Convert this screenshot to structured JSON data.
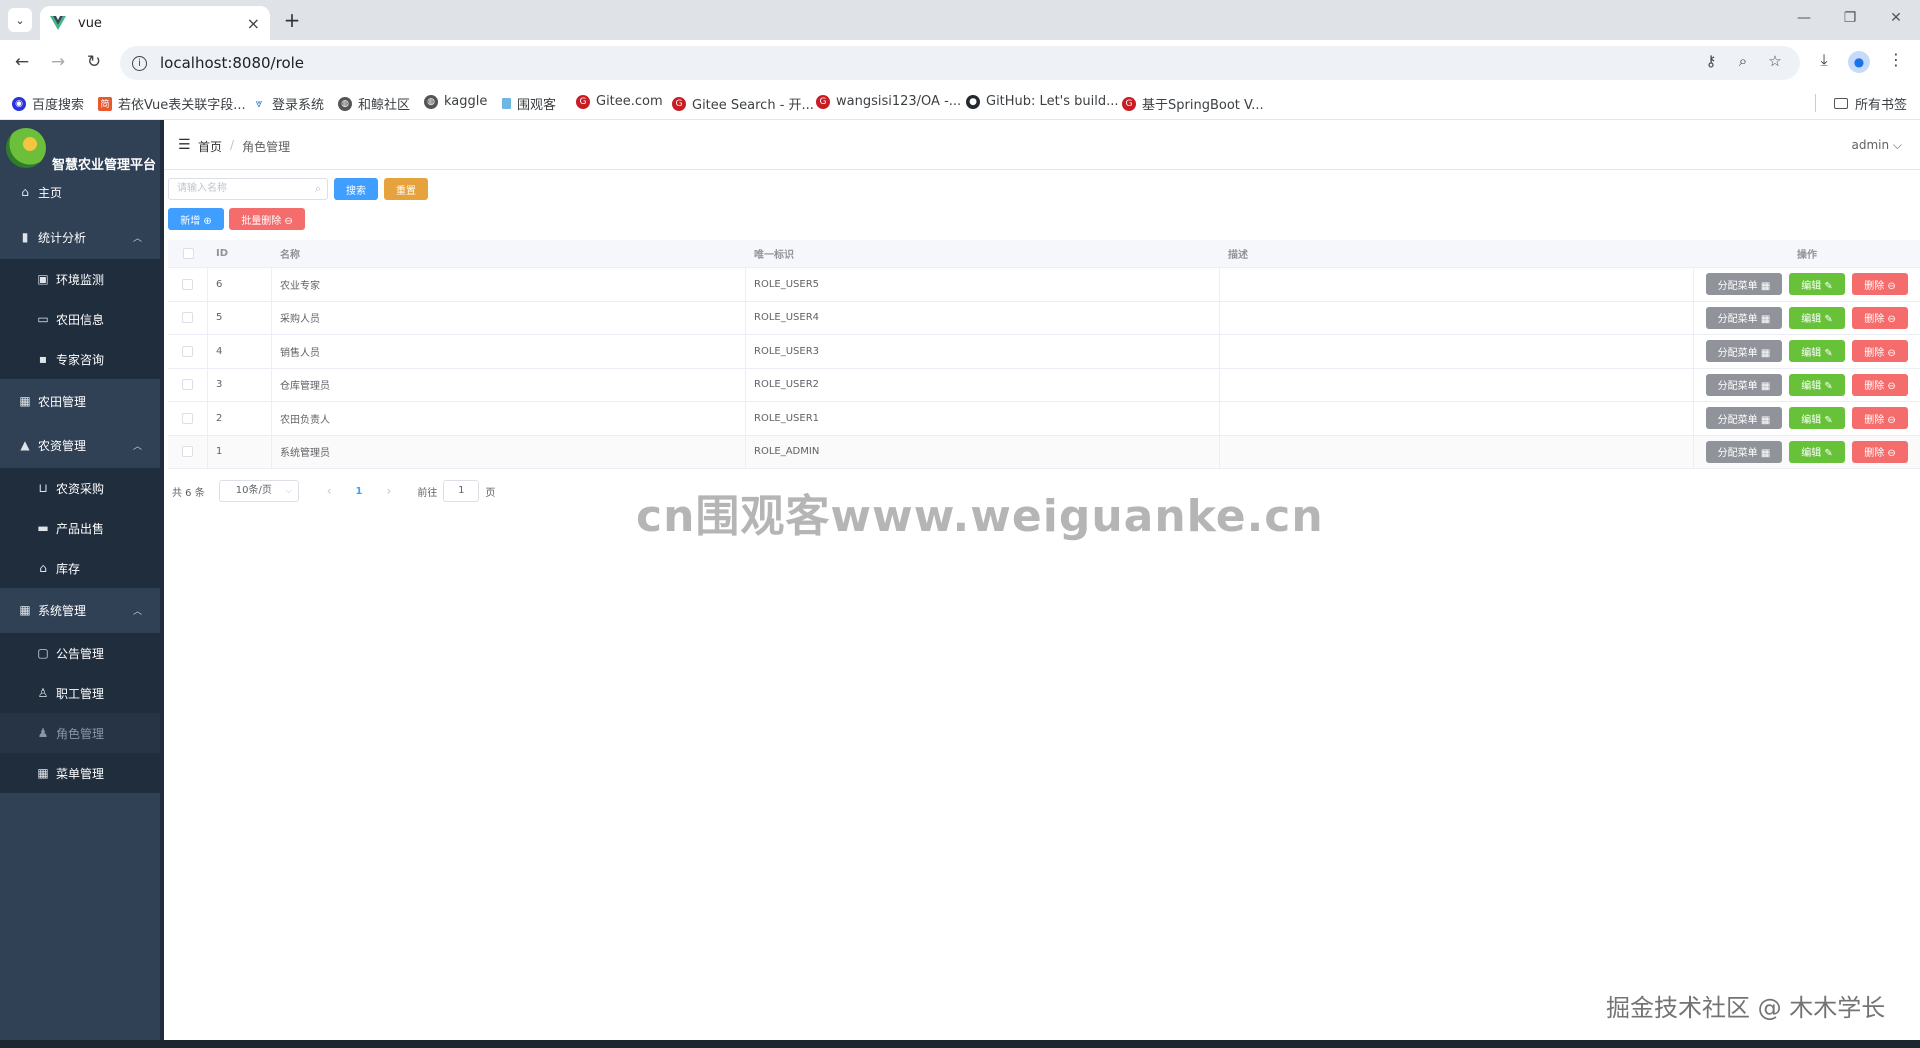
{
  "browser": {
    "tab_title": "vue",
    "url": "localhost:8080/role",
    "bookmarks": [
      {
        "label": "百度搜索",
        "icon": "baidu-icon",
        "color": "#2932e1"
      },
      {
        "label": "若依Vue表关联字段...",
        "icon": "jian-icon",
        "color": "#e8582c"
      },
      {
        "label": "登录系统",
        "icon": "leaf-icon",
        "color": "#3a7bd5"
      },
      {
        "label": "和鲸社区",
        "icon": "globe-icon",
        "color": "#555555"
      },
      {
        "label": "kaggle",
        "icon": "globe-icon",
        "color": "#555555"
      },
      {
        "label": "围观客",
        "icon": "page-icon",
        "color": "#6fb6e0"
      },
      {
        "label": "Gitee.com",
        "icon": "gitee-icon",
        "color": "#c71d23"
      },
      {
        "label": "Gitee Search - 开...",
        "icon": "gitee-icon",
        "color": "#c71d23"
      },
      {
        "label": "wangsisi123/OA -...",
        "icon": "gitee-icon",
        "color": "#c71d23"
      },
      {
        "label": "GitHub: Let's build...",
        "icon": "github-icon",
        "color": "#24292f"
      },
      {
        "label": "基于SpringBoot V...",
        "icon": "gitee-icon",
        "color": "#c71d23"
      }
    ],
    "all_bookmarks": "所有书签"
  },
  "sidebar": {
    "brand": "智慧农业管理平台",
    "items": [
      {
        "label": "主页",
        "icon": "home-icon",
        "glyph": "⌂",
        "level": "top"
      },
      {
        "label": "统计分析",
        "icon": "bar-chart-icon",
        "glyph": "▮",
        "level": "top",
        "expanded": true
      },
      {
        "label": "环境监测",
        "icon": "monitor-icon",
        "glyph": "▣",
        "level": "sub"
      },
      {
        "label": "农田信息",
        "icon": "board-icon",
        "glyph": "▭",
        "level": "sub"
      },
      {
        "label": "专家咨询",
        "icon": "chat-icon",
        "glyph": "▪",
        "level": "sub"
      },
      {
        "label": "农田管理",
        "icon": "grid-icon",
        "glyph": "▦",
        "level": "top"
      },
      {
        "label": "农资管理",
        "icon": "lock-icon",
        "glyph": "▲",
        "level": "top",
        "expanded": true
      },
      {
        "label": "农资采购",
        "icon": "cart-icon",
        "glyph": "⊔",
        "level": "sub"
      },
      {
        "label": "产品出售",
        "icon": "bag-icon",
        "glyph": "▬",
        "level": "sub"
      },
      {
        "label": "库存",
        "icon": "house-icon",
        "glyph": "⌂",
        "level": "sub"
      },
      {
        "label": "系统管理",
        "icon": "apps-icon",
        "glyph": "▦",
        "level": "top",
        "expanded": true
      },
      {
        "label": "公告管理",
        "icon": "notice-icon",
        "glyph": "▢",
        "level": "sub"
      },
      {
        "label": "职工管理",
        "icon": "user-icon",
        "glyph": "♙",
        "level": "sub"
      },
      {
        "label": "角色管理",
        "icon": "role-icon",
        "glyph": "♟",
        "level": "sub",
        "active": true
      },
      {
        "label": "菜单管理",
        "icon": "menu-grid-icon",
        "glyph": "▦",
        "level": "sub"
      }
    ]
  },
  "header": {
    "breadcrumb_home": "首页",
    "breadcrumb_sep": "/",
    "breadcrumb_current": "角色管理",
    "user": "admin ⌵"
  },
  "toolbar": {
    "search_placeholder": "请输入名称",
    "search_btn": "搜索",
    "reset_btn": "重置",
    "add_btn": "新增 ⊕",
    "batch_delete_btn": "批量删除 ⊖"
  },
  "table": {
    "columns": {
      "id": "ID",
      "name": "名称",
      "flag": "唯一标识",
      "desc": "描述",
      "ops": "操作"
    },
    "rows": [
      {
        "id": "6",
        "name": "农业专家",
        "flag": "ROLE_USER5",
        "desc": ""
      },
      {
        "id": "5",
        "name": "采购人员",
        "flag": "ROLE_USER4",
        "desc": ""
      },
      {
        "id": "4",
        "name": "销售人员",
        "flag": "ROLE_USER3",
        "desc": ""
      },
      {
        "id": "3",
        "name": "仓库管理员",
        "flag": "ROLE_USER2",
        "desc": ""
      },
      {
        "id": "2",
        "name": "农田负责人",
        "flag": "ROLE_USER1",
        "desc": ""
      },
      {
        "id": "1",
        "name": "系统管理员",
        "flag": "ROLE_ADMIN",
        "desc": ""
      }
    ],
    "assign_menu_btn": "分配菜单 ▦",
    "edit_btn": "编辑 ✎",
    "delete_btn": "删除 ⊖"
  },
  "pagination": {
    "total": "共 6 条",
    "page_size": "10条/页",
    "current_page": "1",
    "goto_label": "前往",
    "goto_value": "1",
    "page_unit": "页"
  },
  "overlay": {
    "watermark": "cn围观客www.weiguanke.cn",
    "signature": "掘金技术社区 @ 木木学长"
  }
}
